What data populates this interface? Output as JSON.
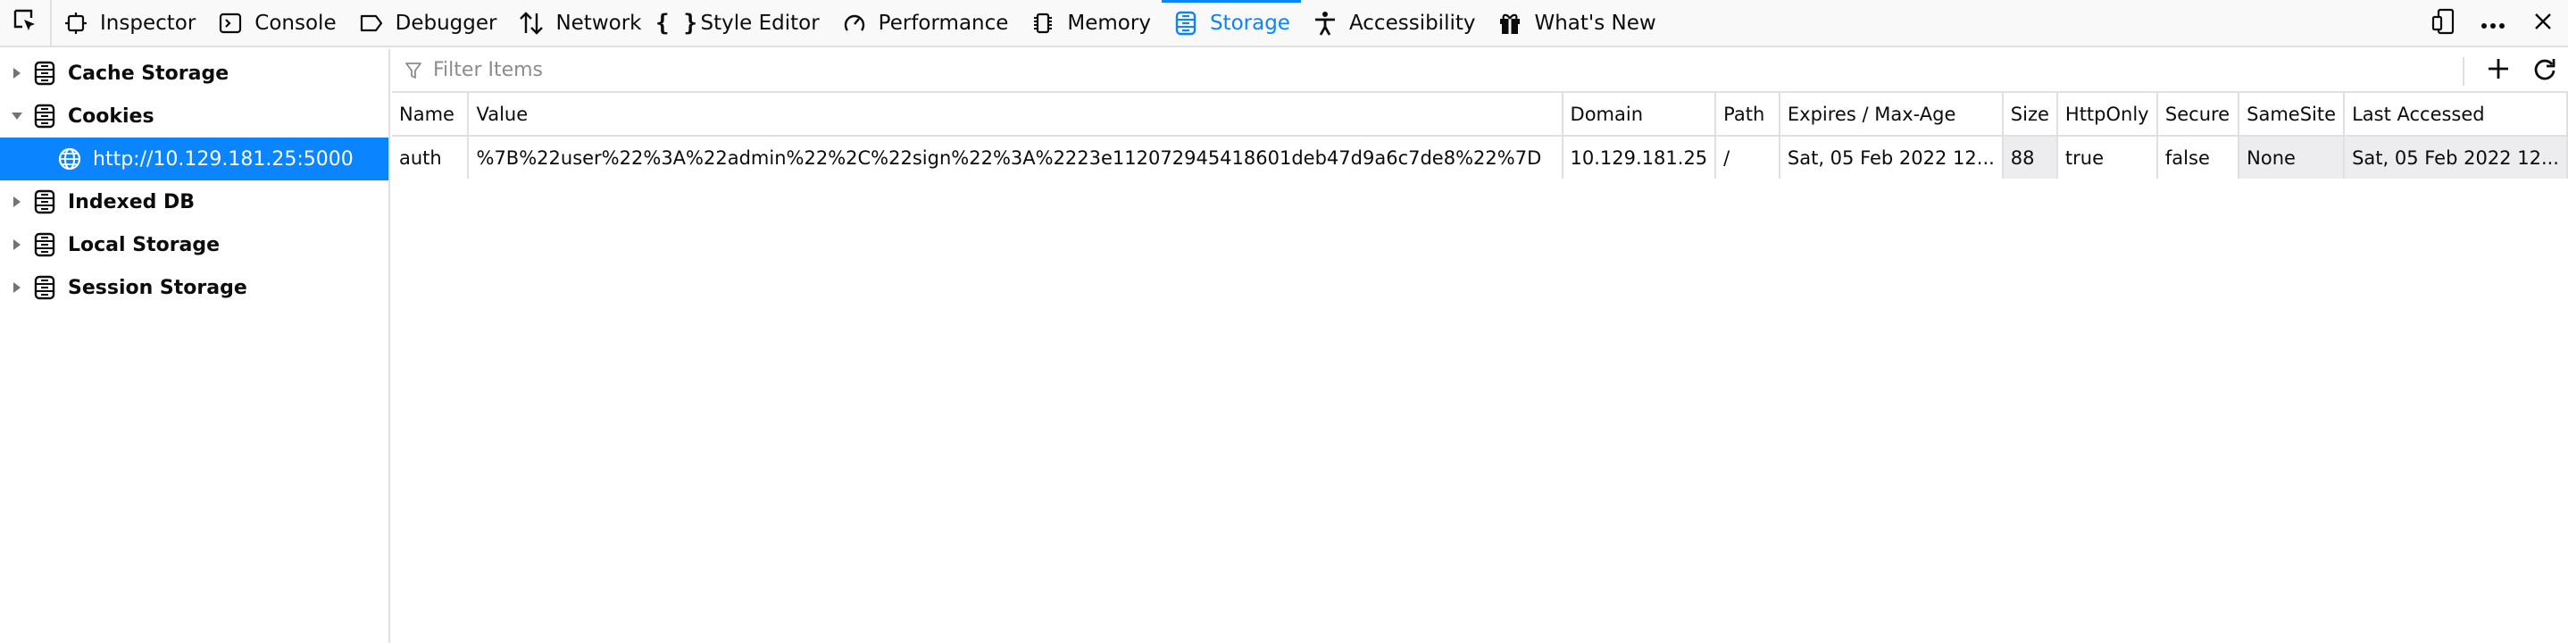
{
  "toolbar": {
    "tabs": [
      {
        "label": "Inspector",
        "icon": "inspector-icon"
      },
      {
        "label": "Console",
        "icon": "console-icon"
      },
      {
        "label": "Debugger",
        "icon": "debugger-icon"
      },
      {
        "label": "Network",
        "icon": "network-icon"
      },
      {
        "label": "Style Editor",
        "icon": "style-editor-icon"
      },
      {
        "label": "Performance",
        "icon": "performance-icon"
      },
      {
        "label": "Memory",
        "icon": "memory-icon"
      },
      {
        "label": "Storage",
        "icon": "storage-icon"
      },
      {
        "label": "Accessibility",
        "icon": "accessibility-icon"
      },
      {
        "label": "What's New",
        "icon": "gift-icon"
      }
    ],
    "active_tab": "Storage",
    "accent_color": "#0a84ff"
  },
  "sidebar": {
    "items": [
      {
        "label": "Cache Storage"
      },
      {
        "label": "Cookies",
        "children": [
          {
            "label": "http://10.129.181.25:5000"
          }
        ]
      },
      {
        "label": "Indexed DB"
      },
      {
        "label": "Local Storage"
      },
      {
        "label": "Session Storage"
      }
    ]
  },
  "filter": {
    "placeholder": "Filter Items",
    "value": ""
  },
  "table": {
    "headers": [
      "Name",
      "Value",
      "Domain",
      "Path",
      "Expires / Max-Age",
      "Size",
      "HttpOnly",
      "Secure",
      "SameSite",
      "Last Accessed"
    ],
    "rows": [
      [
        "auth",
        "%7B%22user%22%3A%22admin%22%2C%22sign%22%3A%2223e112072945418601deb47d9a6c7de8%22%7D",
        "10.129.181.25",
        "/",
        "Sat, 05 Feb 2022 12...",
        "88",
        "true",
        "false",
        "None",
        "Sat, 05 Feb 2022 12..."
      ]
    ]
  }
}
